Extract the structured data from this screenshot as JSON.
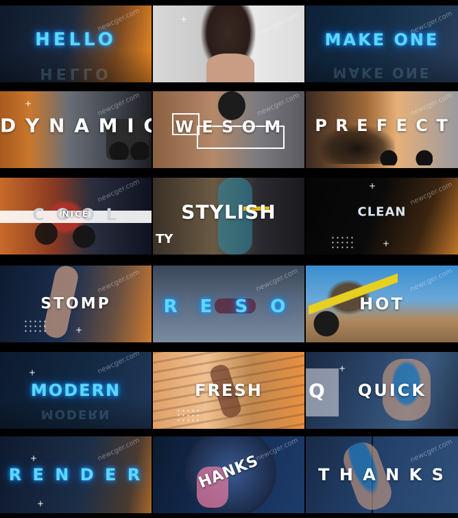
{
  "watermark": "newcger.com",
  "tiles": [
    {
      "label": "HELLO",
      "reflection": "HELLO"
    },
    {
      "label": ""
    },
    {
      "label": "MAKE ONE",
      "reflection": "MAKE ONE"
    },
    {
      "label": "D Y N A M I C"
    },
    {
      "label": "W E S O M"
    },
    {
      "label": "P R E F E C T"
    },
    {
      "label": "NICE",
      "overlay": "C O O L"
    },
    {
      "label": "STYLISH",
      "corner": "TY"
    },
    {
      "label": "CLEAN"
    },
    {
      "label": "STOMP"
    },
    {
      "label": "R E S O"
    },
    {
      "label": "HOT"
    },
    {
      "label": "MODERN",
      "reflection": "MODERN"
    },
    {
      "label": "FRESH"
    },
    {
      "label": "QUICK",
      "prefix": "Q"
    },
    {
      "label": "R E N D E R"
    },
    {
      "label": "HANKS"
    },
    {
      "label": "T H A N K S"
    }
  ],
  "colors": {
    "neon": "#5fd6ff",
    "orange": "#f08a24",
    "navy": "#0e1e3c"
  }
}
